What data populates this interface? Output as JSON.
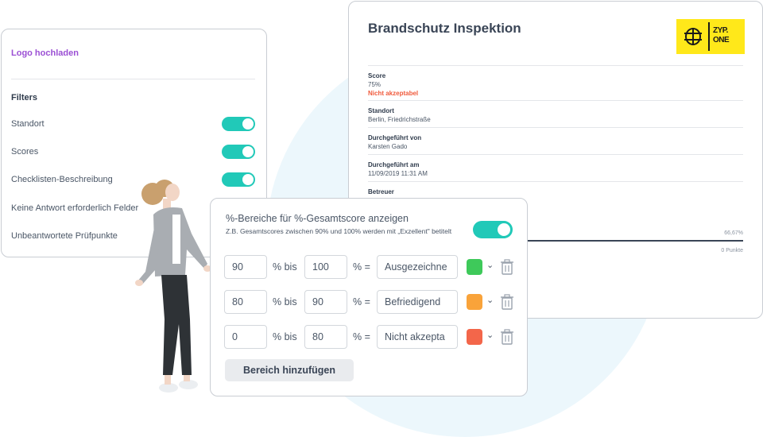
{
  "left_panel": {
    "upload_logo": "Logo hochladen",
    "filters_title": "Filters",
    "filters": [
      {
        "label": "Standort",
        "on": true
      },
      {
        "label": "Scores",
        "on": true
      },
      {
        "label": "Checklisten-Beschreibung",
        "on": true
      },
      {
        "label": "Keine Antwort erforderlich Felder",
        "on": false
      },
      {
        "label": "Unbeantwortete Prüfpunkte",
        "on": false
      }
    ]
  },
  "report": {
    "title": "Brandschutz Inspektion",
    "logo_text_1": "ZYP.",
    "logo_text_2": "ONE",
    "score_label": "Score",
    "score_value": "75%",
    "score_status": "Nicht akzeptabel",
    "location_label": "Standort",
    "location_value": "Berlin, Friedrichstraße",
    "performed_by_label": "Durchgeführt von",
    "performed_by_value": "Karsten Gado",
    "performed_on_label": "Durchgeführt am",
    "performed_on_value": "11/09/2019 11:31 AM",
    "supervisor_label": "Betreuer",
    "progress_text": "66,67%",
    "points_text": "0 Punkte"
  },
  "dialog": {
    "title": "%-Bereiche für %-Gesamtscore anzeigen",
    "subtitle": "Z.B. Gesamtscores zwischen 90% und 100% werden mit „Exzellent\" betitelt",
    "toggle_on": true,
    "ranges": [
      {
        "from": "90",
        "bis": "% bis",
        "to": "100",
        "eq": "% =",
        "label": "Ausgezeichne",
        "color": "#3ec95a"
      },
      {
        "from": "80",
        "bis": "% bis",
        "to": "90",
        "eq": "% =",
        "label": "Befriedigend",
        "color": "#f9a33a"
      },
      {
        "from": "0",
        "bis": "% bis",
        "to": "80",
        "eq": "% =",
        "label": "Nicht akzepta",
        "color": "#f3664a"
      }
    ],
    "add_button": "Bereich hinzufügen"
  }
}
